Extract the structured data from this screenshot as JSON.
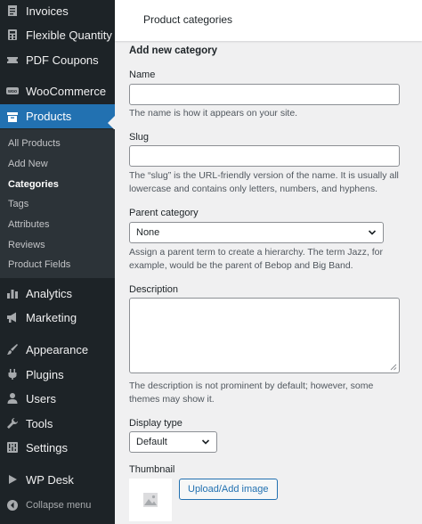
{
  "sidebar": {
    "top_items": [
      {
        "label": "Invoices",
        "icon": "invoice-icon"
      },
      {
        "label": "Flexible Quantity",
        "icon": "calculator-icon"
      },
      {
        "label": "PDF Coupons",
        "icon": "ticket-icon"
      },
      {
        "label": "WooCommerce",
        "icon": "woocommerce-icon"
      },
      {
        "label": "Products",
        "icon": "archive-icon"
      }
    ],
    "submenu": [
      "All Products",
      "Add New",
      "Categories",
      "Tags",
      "Attributes",
      "Reviews",
      "Product Fields"
    ],
    "bottom_items": [
      {
        "label": "Analytics",
        "icon": "chart-bar-icon"
      },
      {
        "label": "Marketing",
        "icon": "megaphone-icon"
      },
      {
        "label": "Appearance",
        "icon": "paintbrush-icon"
      },
      {
        "label": "Plugins",
        "icon": "plugin-icon"
      },
      {
        "label": "Users",
        "icon": "user-icon"
      },
      {
        "label": "Tools",
        "icon": "wrench-icon"
      },
      {
        "label": "Settings",
        "icon": "settings-icon"
      },
      {
        "label": "WP Desk",
        "icon": "play-icon"
      }
    ],
    "collapse": "Collapse menu"
  },
  "header": {
    "title": "Product categories"
  },
  "form": {
    "heading": "Add new category",
    "name": {
      "label": "Name",
      "value": "",
      "help": "The name is how it appears on your site."
    },
    "slug": {
      "label": "Slug",
      "value": "",
      "help": "The “slug” is the URL-friendly version of the name. It is usually all lowercase and contains only letters, numbers, and hyphens."
    },
    "parent": {
      "label": "Parent category",
      "value": "None",
      "help": "Assign a parent term to create a hierarchy. The term Jazz, for example, would be the parent of Bebop and Big Band."
    },
    "description": {
      "label": "Description",
      "value": "",
      "help": "The description is not prominent by default; however, some themes may show it."
    },
    "display_type": {
      "label": "Display type",
      "value": "Default"
    },
    "thumbnail": {
      "label": "Thumbnail",
      "button": "Upload/Add image"
    }
  },
  "colors": {
    "sidebar_bg": "#1d2327",
    "submenu_bg": "#2c3338",
    "accent": "#2271b1",
    "page_bg": "#f0f0f1"
  }
}
